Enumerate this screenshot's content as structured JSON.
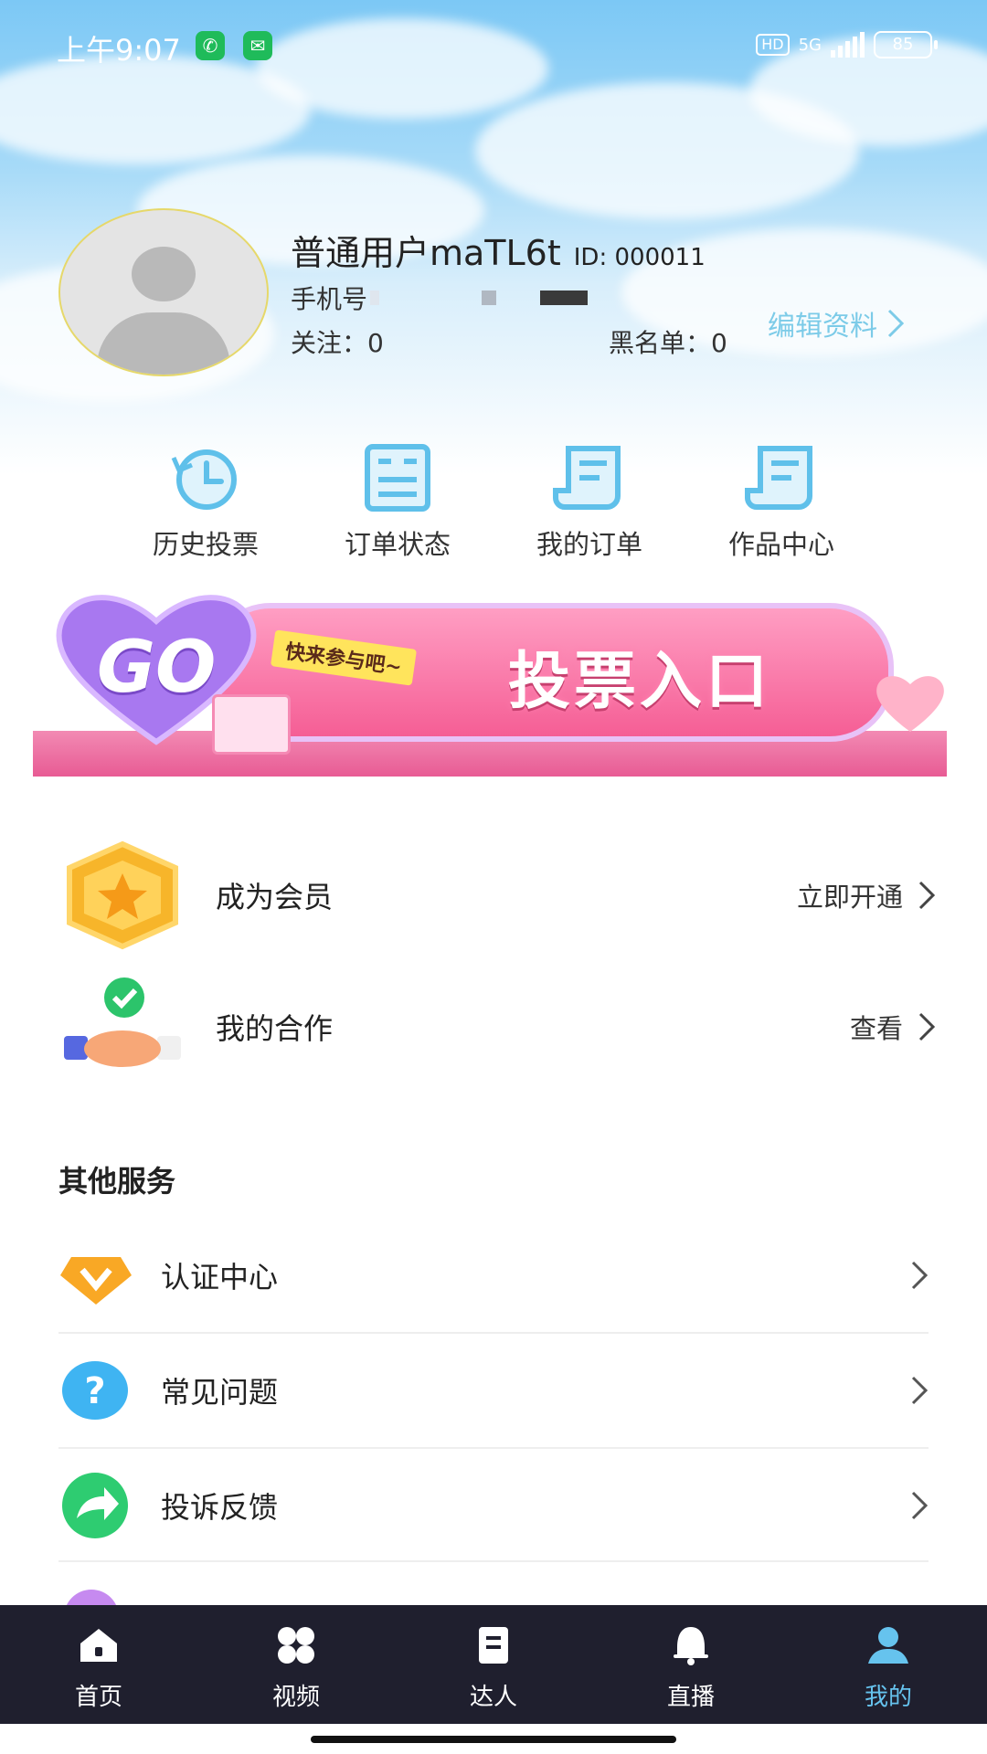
{
  "status_bar": {
    "time": "上午9:07",
    "hd": "HD",
    "network": "5G",
    "battery": "85"
  },
  "profile": {
    "name": "普通用户maTL6t",
    "id_text": "ID: 000011",
    "phone_label": "手机号",
    "follow_text": "关注：0",
    "blacklist_text": "黑名单：0",
    "edit_label": "编辑资料"
  },
  "quick_actions": [
    {
      "label": "历史投票",
      "icon": "history-icon"
    },
    {
      "label": "订单状态",
      "icon": "order-status-icon"
    },
    {
      "label": "我的订单",
      "icon": "my-orders-icon"
    },
    {
      "label": "作品中心",
      "icon": "works-icon"
    }
  ],
  "banner": {
    "go_text": "GO",
    "tag_text": "快来参与吧~",
    "entry_text": "投票入口"
  },
  "features": [
    {
      "title": "成为会员",
      "action": "立即开通",
      "icon": "star-badge-icon"
    },
    {
      "title": "我的合作",
      "action": "查看",
      "icon": "handshake-icon"
    }
  ],
  "other_services": {
    "title": "其他服务",
    "items": [
      {
        "label": "认证中心",
        "icon": "v-badge-icon"
      },
      {
        "label": "常见问题",
        "icon": "question-icon"
      },
      {
        "label": "投诉反馈",
        "icon": "share-arrow-icon"
      }
    ]
  },
  "nav": {
    "items": [
      {
        "label": "首页",
        "icon": "home-icon"
      },
      {
        "label": "视频",
        "icon": "video-icon"
      },
      {
        "label": "达人",
        "icon": "book-icon"
      },
      {
        "label": "直播",
        "icon": "bell-icon"
      },
      {
        "label": "我的",
        "icon": "user-icon"
      }
    ],
    "active": "我的"
  },
  "colors": {
    "accent": "#66c3ee",
    "nav_bg": "#1f1f2e",
    "banner_pink": "#f55e95"
  }
}
